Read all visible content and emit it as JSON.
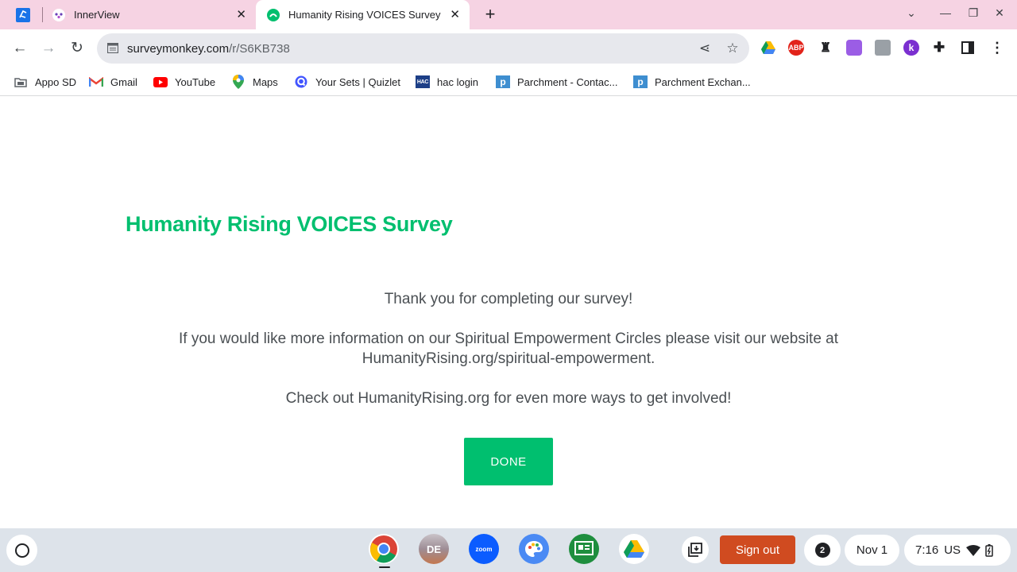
{
  "browser": {
    "tabs": [
      {
        "title": "InnerView"
      },
      {
        "title": "Humanity Rising VOICES Survey"
      }
    ],
    "close_glyph": "✕",
    "newtab_glyph": "+",
    "window_controls": {
      "chevron": "⌄",
      "minimize": "—",
      "restore": "❐",
      "close": "✕"
    },
    "url_domain": "surveymonkey.com",
    "url_path": "/r/S6KB738",
    "extensions": [
      {
        "name": "google-drive-ext",
        "label": ""
      },
      {
        "name": "adblock-plus-ext",
        "label": "ABP"
      },
      {
        "name": "ghost-ext",
        "label": ""
      },
      {
        "name": "puzzle-purple-ext",
        "label": ""
      },
      {
        "name": "stack-ext",
        "label": ""
      },
      {
        "name": "k-ext",
        "label": "k"
      },
      {
        "name": "extensions-puzzle",
        "label": ""
      }
    ]
  },
  "bookmarks": [
    {
      "label": "Appo SD",
      "icon": "folder-icon"
    },
    {
      "label": "Gmail",
      "icon": "gmail-icon"
    },
    {
      "label": "YouTube",
      "icon": "youtube-icon"
    },
    {
      "label": "Maps",
      "icon": "maps-icon"
    },
    {
      "label": "Your Sets | Quizlet",
      "icon": "quizlet-icon"
    },
    {
      "label": "hac login",
      "icon": "hac-icon",
      "badge": "HAC"
    },
    {
      "label": "Parchment - Contac...",
      "icon": "parchment-icon",
      "badge": "p"
    },
    {
      "label": "Parchment Exchan...",
      "icon": "parchment-icon",
      "badge": "p"
    }
  ],
  "survey": {
    "title": "Humanity Rising VOICES Survey",
    "thanks": "Thank you for completing our survey!",
    "info_line1": "If you would like more information on our Spiritual Empowerment Circles please visit our website at",
    "info_line2": "HumanityRising.org/spiritual-empowerment.",
    "checkout": "Check out HumanityRising.org for even more ways to get involved!",
    "done_label": "DONE"
  },
  "shelf": {
    "apps": [
      {
        "name": "chrome-app",
        "label": ""
      },
      {
        "name": "photo-app",
        "label": "DE"
      },
      {
        "name": "zoom-app",
        "label": "zoom"
      },
      {
        "name": "canvas-app",
        "label": ""
      },
      {
        "name": "classroom-app",
        "label": ""
      },
      {
        "name": "drive-app",
        "label": ""
      }
    ],
    "signout_label": "Sign out",
    "notification_count": "2",
    "date": "Nov 1",
    "time": "7:16",
    "locale": "US"
  },
  "colors": {
    "accent": "#00bf6f",
    "tabstrip": "#f6d3e3",
    "signout": "#d04b20"
  }
}
